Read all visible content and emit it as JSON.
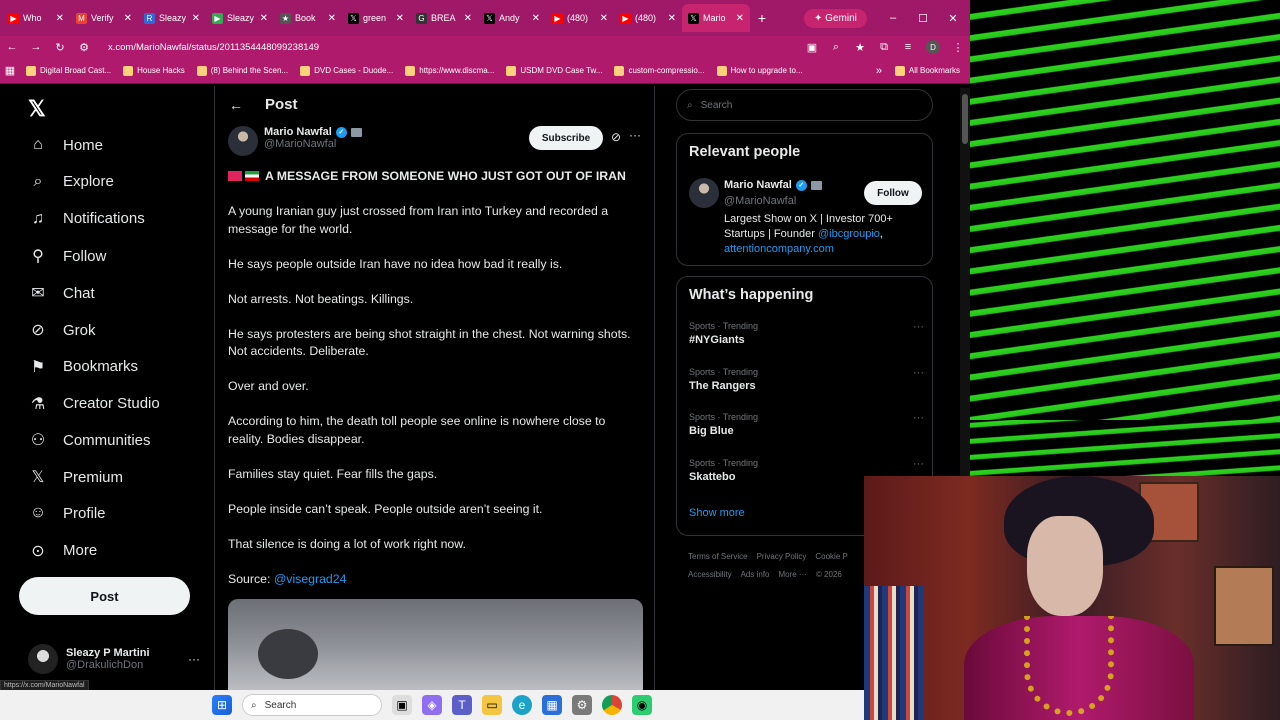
{
  "colors": {
    "tabbar": "#a01868",
    "x_background": "#000000",
    "x_text": "#e7e9ea",
    "x_muted": "#71767b",
    "x_link": "#1d9bf0",
    "green_stripes": "#2ed420"
  },
  "browser": {
    "tabs": [
      {
        "label": "Who",
        "icon": "youtube-icon"
      },
      {
        "label": "Verify",
        "icon": "gmail-icon"
      },
      {
        "label": "Sleazy",
        "icon": "r-icon"
      },
      {
        "label": "Sleazy",
        "icon": "play-icon"
      },
      {
        "label": "Book",
        "icon": "star-icon"
      },
      {
        "label": "green",
        "icon": "x-icon"
      },
      {
        "label": "BREA",
        "icon": "gp-icon"
      },
      {
        "label": "Andy",
        "icon": "x-icon"
      },
      {
        "label": "(480)",
        "icon": "youtube-icon"
      },
      {
        "label": "(480)",
        "icon": "youtube-icon"
      },
      {
        "label": "Mario",
        "icon": "x-icon"
      }
    ],
    "new_tab": "+",
    "gemini_label": "Gemini",
    "url": "x.com/MarioNawfal/status/2011354448099238149",
    "bookmarks": [
      "Digital Broad Cast...",
      "House Hacks",
      "(8) Behind the Scen...",
      "DVD Cases - Duode...",
      "https://www.discma...",
      "USDM DVD Case Tw...",
      "custom-compressio...",
      "How to upgrade to..."
    ],
    "all_bookmarks": "All Bookmarks",
    "profile_initial": "D"
  },
  "x": {
    "nav": [
      {
        "label": "Home",
        "icon": "home-icon",
        "glyph": "⌂"
      },
      {
        "label": "Explore",
        "icon": "search-icon",
        "glyph": "⌕"
      },
      {
        "label": "Notifications",
        "icon": "bell-icon",
        "glyph": "♫"
      },
      {
        "label": "Follow",
        "icon": "person-add-icon",
        "glyph": "⚲"
      },
      {
        "label": "Chat",
        "icon": "mail-icon",
        "glyph": "✉"
      },
      {
        "label": "Grok",
        "icon": "grok-icon",
        "glyph": "⊘"
      },
      {
        "label": "Bookmarks",
        "icon": "bookmark-icon",
        "glyph": "⚑"
      },
      {
        "label": "Creator Studio",
        "icon": "flask-icon",
        "glyph": "⚗"
      },
      {
        "label": "Communities",
        "icon": "people-icon",
        "glyph": "⚇"
      },
      {
        "label": "Premium",
        "icon": "x-logo-icon",
        "glyph": "𝕏"
      },
      {
        "label": "Profile",
        "icon": "person-icon",
        "glyph": "☺"
      },
      {
        "label": "More",
        "icon": "more-circle-icon",
        "glyph": "⊙"
      }
    ],
    "post_button": "Post",
    "account": {
      "name": "Sleazy P Martini",
      "handle": "@DrakulichDon"
    },
    "status_url": "https://x.com/MarioNawfal",
    "post": {
      "header": "Post",
      "author_name": "Mario Nawfal",
      "author_handle": "@MarioNawfal",
      "subscribe": "Subscribe",
      "headline": "A MESSAGE FROM SOMEONE WHO JUST GOT OUT OF IRAN",
      "paragraphs": [
        "A young Iranian guy just crossed from Iran into Turkey and recorded a message for the world.",
        "He says people outside Iran have no idea how bad it really is.",
        "Not arrests. Not beatings. Killings.",
        "He says protesters are being shot straight in the chest. Not warning shots. Not accidents. Deliberate.",
        "Over and over.",
        "According to him, the death toll people see online is nowhere close to reality. Bodies disappear.",
        "Families stay quiet. Fear fills the gaps.",
        "People inside can’t speak. People outside aren’t seeing it.",
        "That silence is doing a lot of work right now."
      ],
      "source_label": "Source:",
      "source_link": "@visegrad24"
    },
    "right": {
      "search_placeholder": "Search",
      "relevant_title": "Relevant people",
      "relevant": {
        "name": "Mario Nawfal",
        "handle": "@MarioNawfal",
        "follow": "Follow",
        "bio_text": "Largest Show on X | Investor 700+ Startups | Founder",
        "bio_link1": "@ibcgroupio",
        "bio_comma": ",",
        "bio_link2": "attentioncompany.com"
      },
      "happening_title": "What’s happening",
      "trends": [
        {
          "meta": "Sports · Trending",
          "name": "#NYGiants"
        },
        {
          "meta": "Sports · Trending",
          "name": "The Rangers"
        },
        {
          "meta": "Sports · Trending",
          "name": "Big Blue"
        },
        {
          "meta": "Sports · Trending",
          "name": "Skattebo"
        }
      ],
      "show_more": "Show more",
      "footer_row1": [
        "Terms of Service",
        "Privacy Policy",
        "Cookie P"
      ],
      "footer_row2": [
        "Accessibility",
        "Ads info",
        "More ···",
        "© 2026"
      ]
    }
  },
  "taskbar": {
    "search_label": "Search"
  }
}
